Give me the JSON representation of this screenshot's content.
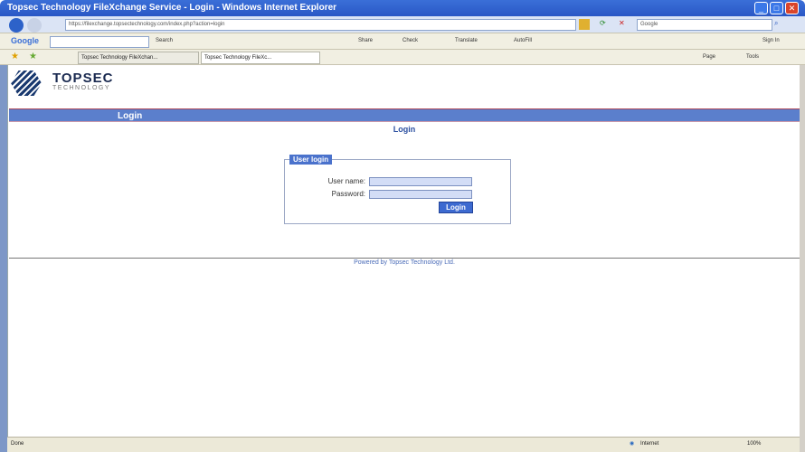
{
  "window": {
    "title": "Topsec Technology FileXchange Service - Login - Windows Internet Explorer"
  },
  "address": {
    "url": "https://filexchange.topsectechnology.com/index.php?action=login",
    "search_placeholder": "Google"
  },
  "google_toolbar": {
    "logo": "Google",
    "search": "Search",
    "share": "Share",
    "check": "Check",
    "translate": "Translate",
    "autofill": "AutoFill",
    "sign_in": "Sign In"
  },
  "tabs": [
    {
      "label": "Topsec Technology FileXchan..."
    },
    {
      "label": "Topsec Technology FileXc..."
    }
  ],
  "command_bar": {
    "page": "Page",
    "tools": "Tools"
  },
  "page": {
    "logo_top": "TOPSEC",
    "logo_bottom": "TECHNOLOGY",
    "bar_title": "Login",
    "heading": "Login",
    "legend": "User login",
    "username_label": "User name:",
    "password_label": "Password:",
    "username_value": "",
    "password_value": "",
    "login_button": "Login",
    "footer": "Powered by Topsec Technology Ltd."
  },
  "status": {
    "text": "Done",
    "zone": "Internet",
    "zoom": "100%"
  }
}
